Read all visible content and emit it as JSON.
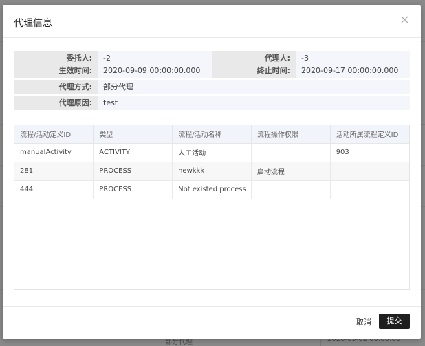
{
  "modal": {
    "title": "代理信息",
    "close_icon": "close-icon"
  },
  "info": {
    "delegator_label": "委托人:",
    "delegator_value": "-2",
    "agent_label": "代理人:",
    "agent_value": "-3",
    "start_label": "生效时间:",
    "start_value": "2020-09-09 00:00:00.000",
    "end_label": "终止时间:",
    "end_value": "2020-09-17 00:00:00.000",
    "mode_label": "代理方式:",
    "mode_value": "部分代理",
    "reason_label": "代理原因:",
    "reason_value": "test"
  },
  "table": {
    "headers": [
      "流程/活动定义ID",
      "类型",
      "流程/活动名称",
      "流程操作权限",
      "活动所属流程定义ID"
    ],
    "rows": [
      [
        "manualActivity",
        "ACTIVITY",
        "人工活动",
        "",
        "903"
      ],
      [
        "281",
        "PROCESS",
        "newkkk",
        "启动流程",
        ""
      ],
      [
        "444",
        "PROCESS",
        "Not existed process",
        "",
        ""
      ]
    ]
  },
  "footer": {
    "cancel_label": "取消",
    "submit_label": "提交"
  },
  "background": {
    "bottom_col1": "部分代理",
    "bottom_col2": "2020-09-02 00:00:00"
  },
  "colors": {
    "submit_bg": "#1f1f1f",
    "label_bg": "#e9e9e9",
    "value_bg": "#f4f6fc",
    "header_bg": "#f2f4fb"
  }
}
